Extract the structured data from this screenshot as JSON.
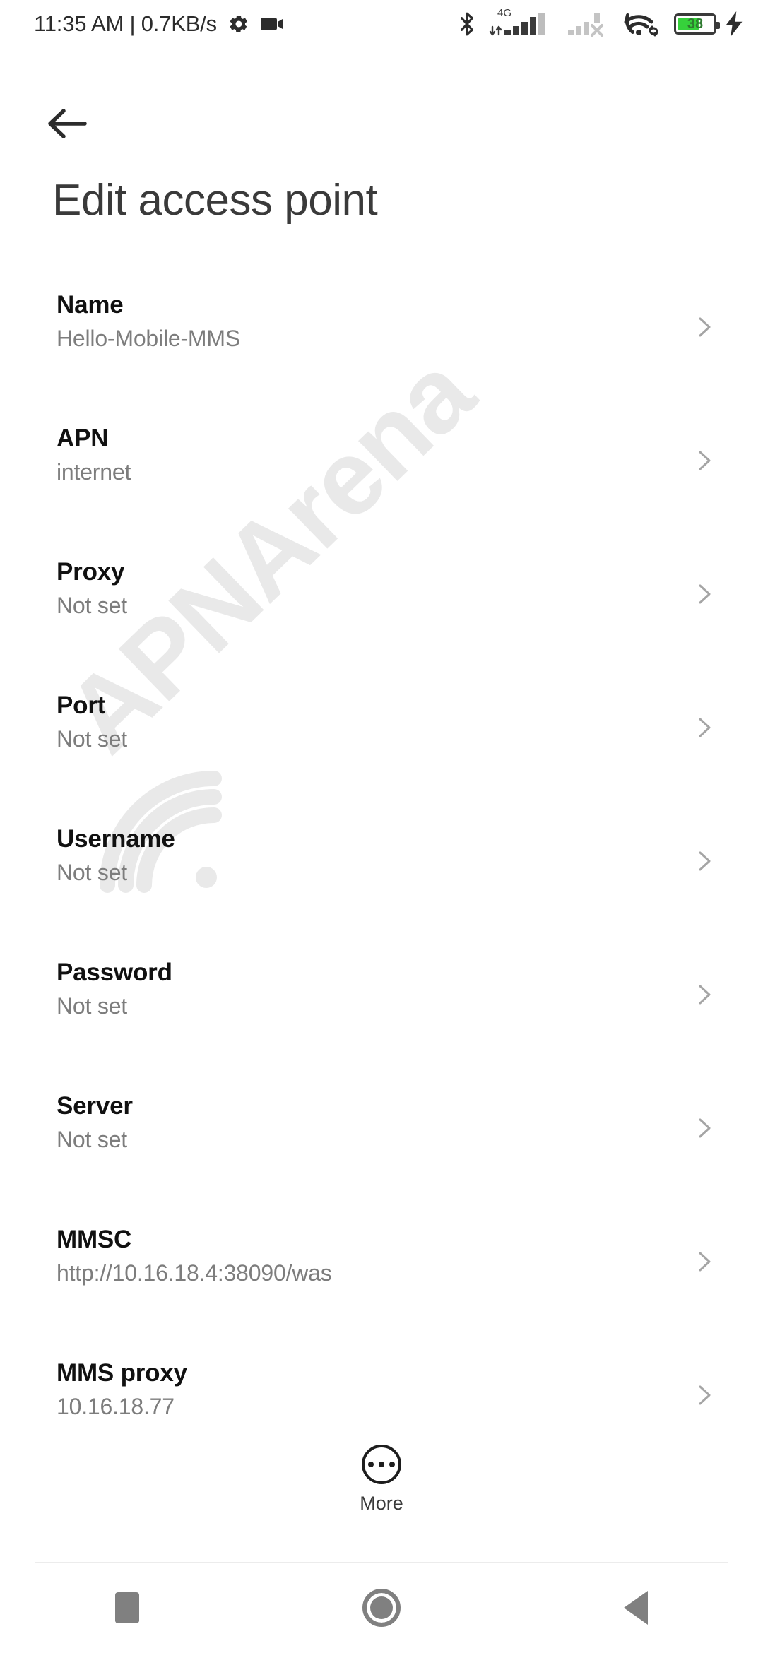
{
  "status_bar": {
    "clock": "11:35 AM | 0.7KB/s",
    "network_speed": "0.7KB/s",
    "time": "11:35 AM",
    "network_type": "4G",
    "battery_percent": "38",
    "battery_charging": true,
    "icons": [
      "gear-icon",
      "video-camera-icon",
      "bluetooth-icon",
      "signal-4g-icon",
      "signal-no-service-icon",
      "wifi-icon",
      "battery-icon",
      "charging-bolt-icon"
    ],
    "colors": {
      "battery_fill": "#36d13b",
      "battery_text": "#2f7a30",
      "icon": "#3a3a3a"
    }
  },
  "header": {
    "back_label": "Back",
    "title": "Edit access point"
  },
  "watermark": {
    "text": "APNArena",
    "color": "#e9e9e9"
  },
  "settings": {
    "rows": [
      {
        "label": "Name",
        "value": "Hello-Mobile-MMS"
      },
      {
        "label": "APN",
        "value": "internet"
      },
      {
        "label": "Proxy",
        "value": "Not set"
      },
      {
        "label": "Port",
        "value": "Not set"
      },
      {
        "label": "Username",
        "value": "Not set"
      },
      {
        "label": "Password",
        "value": "Not set"
      },
      {
        "label": "Server",
        "value": "Not set"
      },
      {
        "label": "MMSC",
        "value": "http://10.16.18.4:38090/was"
      },
      {
        "label": "MMS proxy",
        "value": "10.16.18.77"
      }
    ]
  },
  "more_button": {
    "label": "More"
  },
  "nav_bar": {
    "recents_label": "Recents",
    "home_label": "Home",
    "back_label": "Back"
  }
}
